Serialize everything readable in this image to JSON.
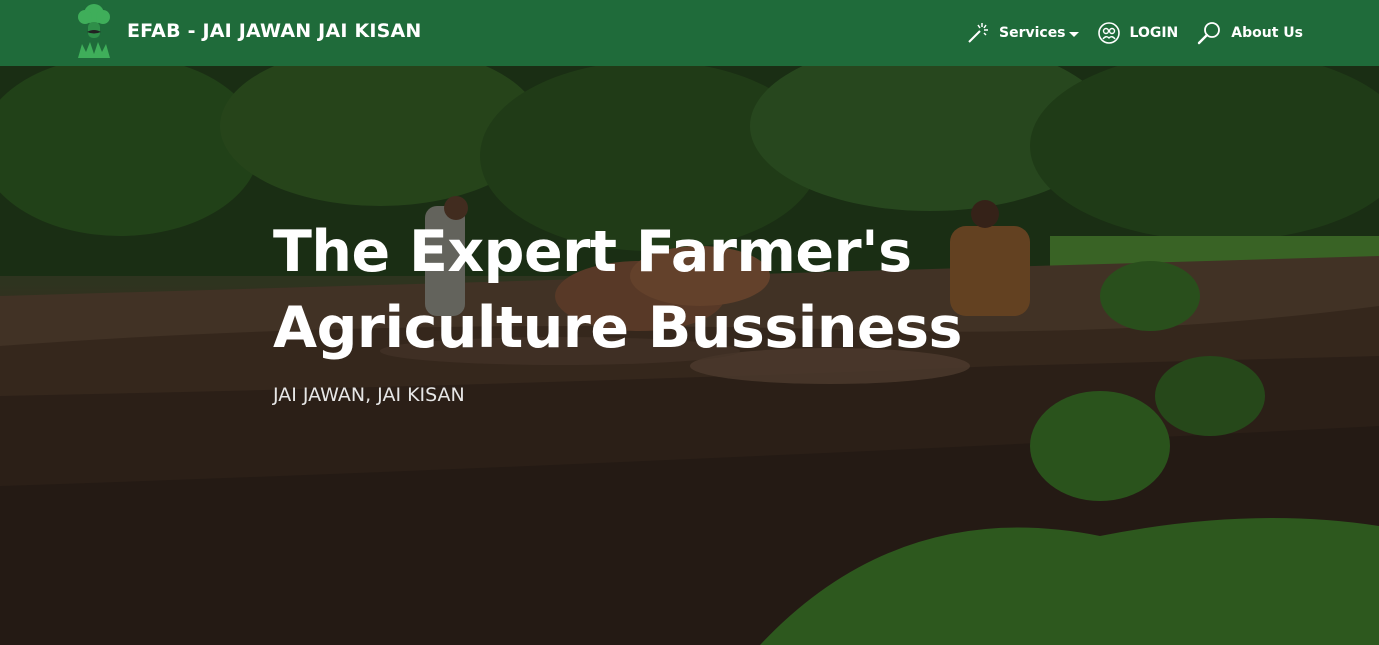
{
  "header": {
    "brand_title": "EFAB - JAI JAWAN JAI KISAN",
    "logo_icon": "farmer-tree-logo-icon",
    "nav": [
      {
        "label": "Services",
        "icon": "magic-wand-icon",
        "has_dropdown": true
      },
      {
        "label": "LOGIN",
        "icon": "user-circle-icon"
      },
      {
        "label": "About Us",
        "icon": "magnifier-icon"
      }
    ]
  },
  "hero": {
    "title_line1": "The Expert Farmer's",
    "title_line2": "Agriculture Bussiness",
    "subtitle": "JAI JAWAN, JAI KISAN"
  },
  "colors": {
    "navbar": "#1f6b3a",
    "text": "#ffffff"
  }
}
